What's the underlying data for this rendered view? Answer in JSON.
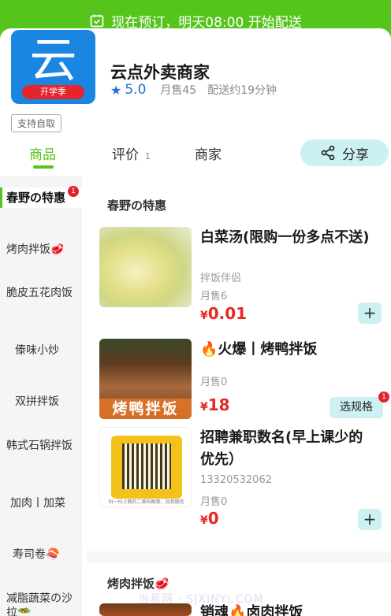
{
  "banner": {
    "text": "现在预订，明天08:00 开始配送"
  },
  "shop": {
    "logo_char": "云",
    "logo_ribbon": "开学季",
    "name": "云点外卖商家",
    "rating": "5.0",
    "monthly_sales": "月售45",
    "delivery_time": "配送约19分钟",
    "pickup_tag": "支持自取"
  },
  "tabs": [
    {
      "label": "商品",
      "count": ""
    },
    {
      "label": "评价",
      "count": "1"
    },
    {
      "label": "商家",
      "count": ""
    }
  ],
  "share": {
    "label": "分享"
  },
  "sidebar": {
    "items": [
      {
        "label": "春野の特惠",
        "badge": "1"
      },
      {
        "label": "烤肉拌饭🥩"
      },
      {
        "label": "脆皮五花肉饭"
      },
      {
        "label": "傣味小炒"
      },
      {
        "label": "双拼拌饭"
      },
      {
        "label": "韩式石锅拌饭"
      },
      {
        "label": "加肉丨加菜"
      },
      {
        "label": "寿司卷🍣"
      },
      {
        "label": "减脂蔬菜の沙拉🥗"
      }
    ]
  },
  "sections": [
    {
      "title": "春野の特惠",
      "items": [
        {
          "name": "白菜汤(限购一份多点不送)",
          "desc": "拌饭伴侣",
          "sales": "月售6",
          "currency": "¥",
          "price": "0.01",
          "action": "+"
        },
        {
          "name": "🔥火爆丨烤鸭拌饭",
          "thumb_text": "烤鸭拌饭",
          "sales": "月售0",
          "currency": "¥",
          "price": "18",
          "action": "选规格",
          "action_badge": "1"
        },
        {
          "name": "招聘兼职数名(早上课少的优先）",
          "desc": "13320532062",
          "sales": "月售0",
          "currency": "¥",
          "price": "0",
          "action": "+",
          "thumb_caption": "扫一扫上面的二维码图案，加我微信"
        }
      ]
    },
    {
      "title": "烤肉拌饭🥩",
      "items": [
        {
          "name": "销魂🔥卤肉拌饭"
        }
      ]
    }
  ],
  "watermark": "当易网 · SJXINYI.COM"
}
